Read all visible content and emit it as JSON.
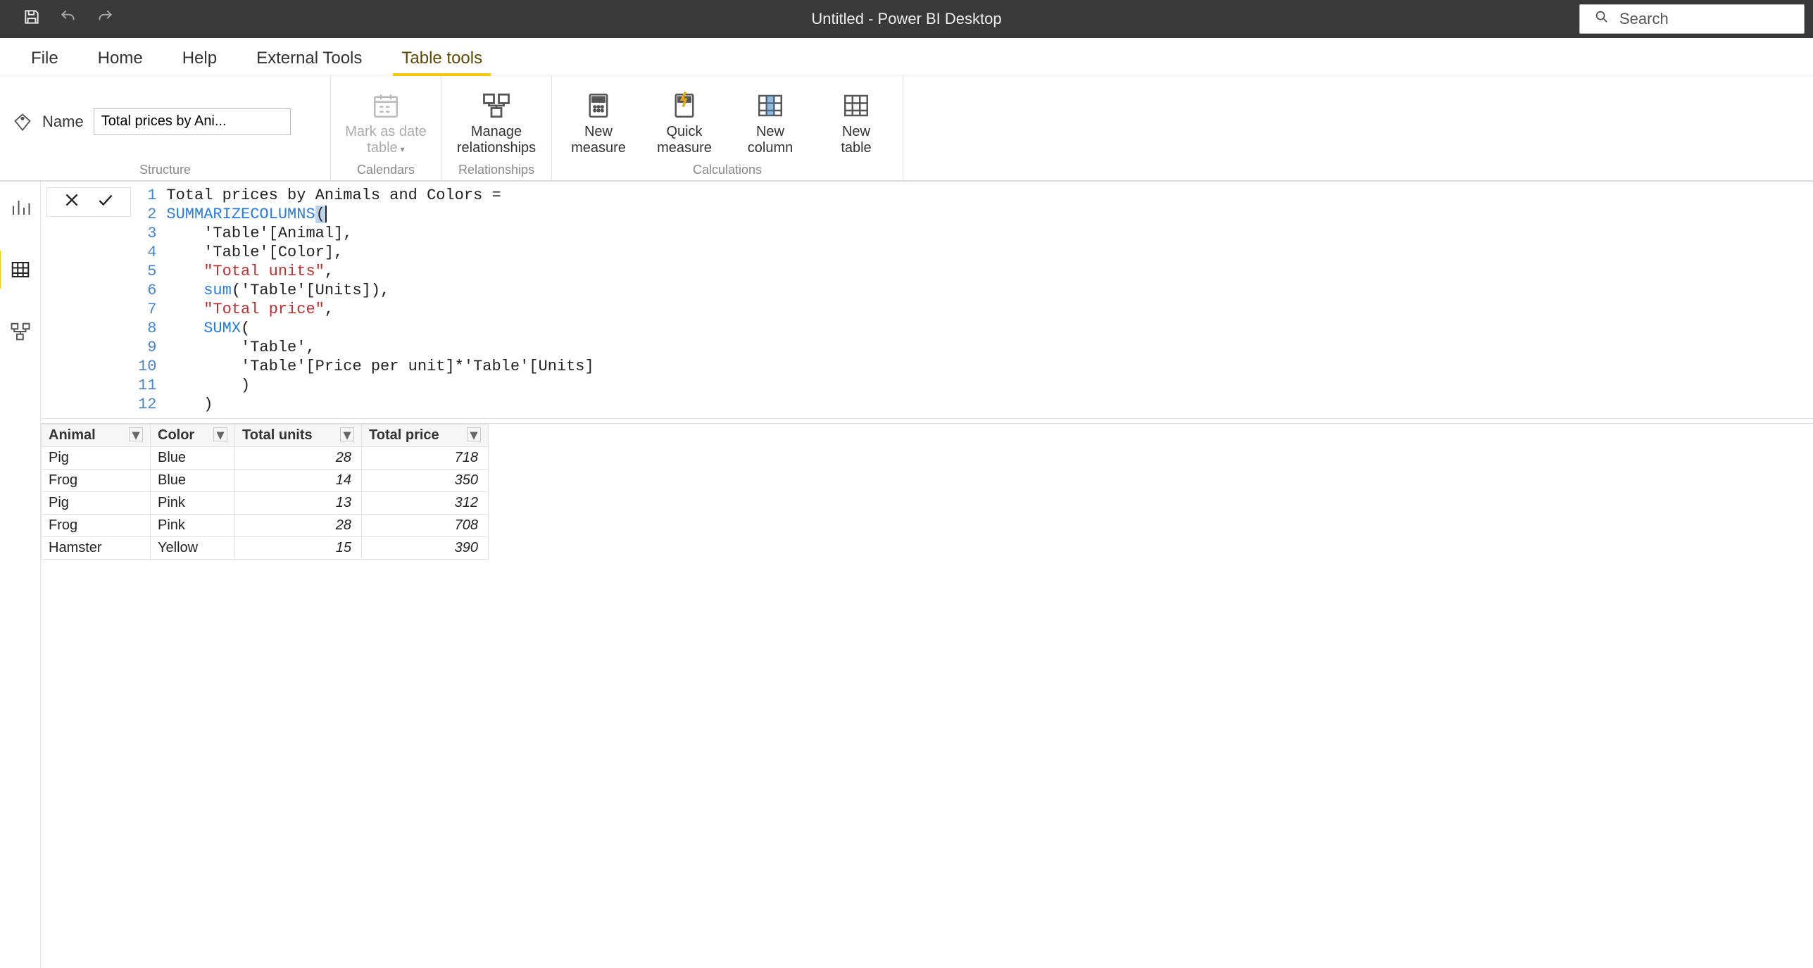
{
  "titlebar": {
    "title": "Untitled - Power BI Desktop",
    "search_placeholder": "Search"
  },
  "tabs": {
    "file": "File",
    "home": "Home",
    "help": "Help",
    "external_tools": "External Tools",
    "table_tools": "Table tools"
  },
  "ribbon": {
    "structure": {
      "name_label": "Name",
      "name_value": "Total prices by Ani...",
      "group_label": "Structure"
    },
    "calendars": {
      "mark_as_date_table": "Mark as date\ntable",
      "group_label": "Calendars"
    },
    "relationships": {
      "manage_relationships": "Manage\nrelationships",
      "group_label": "Relationships"
    },
    "calculations": {
      "new_measure": "New\nmeasure",
      "quick_measure": "Quick\nmeasure",
      "new_column": "New\ncolumn",
      "new_table": "New\ntable",
      "group_label": "Calculations"
    }
  },
  "formula": {
    "lines": [
      "Total prices by Animals and Colors =",
      "SUMMARIZECOLUMNS(",
      "    'Table'[Animal],",
      "    'Table'[Color],",
      "    \"Total units\",",
      "    sum('Table'[Units]),",
      "    \"Total price\",",
      "    SUMX(",
      "        'Table',",
      "        'Table'[Price per unit]*'Table'[Units]",
      "        )",
      "    )"
    ]
  },
  "results": {
    "columns": [
      "Animal",
      "Color",
      "Total units",
      "Total price"
    ],
    "rows": [
      {
        "animal": "Pig",
        "color": "Blue",
        "units": 28,
        "price": 718
      },
      {
        "animal": "Frog",
        "color": "Blue",
        "units": 14,
        "price": 350
      },
      {
        "animal": "Pig",
        "color": "Pink",
        "units": 13,
        "price": 312
      },
      {
        "animal": "Frog",
        "color": "Pink",
        "units": 28,
        "price": 708
      },
      {
        "animal": "Hamster",
        "color": "Yellow",
        "units": 15,
        "price": 390
      }
    ]
  },
  "chart_data": {
    "type": "table",
    "title": "Total prices by Animals and Colors",
    "columns": [
      "Animal",
      "Color",
      "Total units",
      "Total price"
    ],
    "rows": [
      [
        "Pig",
        "Blue",
        28,
        718
      ],
      [
        "Frog",
        "Blue",
        14,
        350
      ],
      [
        "Pig",
        "Pink",
        13,
        312
      ],
      [
        "Frog",
        "Pink",
        28,
        708
      ],
      [
        "Hamster",
        "Yellow",
        15,
        390
      ]
    ]
  }
}
